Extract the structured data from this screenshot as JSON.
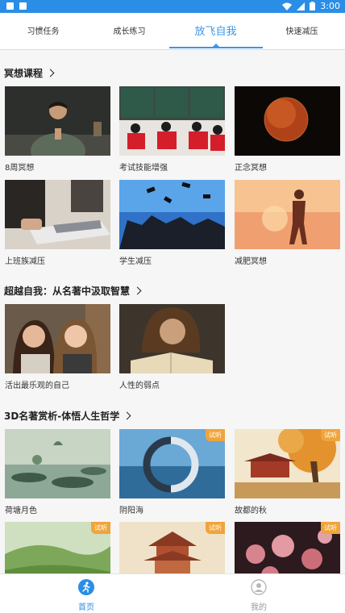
{
  "status_bar": {
    "time": "3:00"
  },
  "tabs": [
    {
      "label": "习惯任务"
    },
    {
      "label": "成长练习"
    },
    {
      "label": "放飞自我"
    },
    {
      "label": "快速减压"
    }
  ],
  "sections": {
    "meditation": {
      "title": "冥想课程",
      "cards": [
        {
          "label": "8周冥想",
          "image": "woman-meditating-image"
        },
        {
          "label": "考试技能增强",
          "image": "exam-classroom-image"
        },
        {
          "label": "正念冥想",
          "image": "eclipse-moon-image"
        },
        {
          "label": "上班族减压",
          "image": "office-laptop-image"
        },
        {
          "label": "学生减压",
          "image": "graduation-image"
        },
        {
          "label": "减肥冥想",
          "image": "runner-sunset-image"
        }
      ]
    },
    "beyond": {
      "title": "超越自我：从名著中汲取智慧",
      "cards": [
        {
          "label": "活出最乐观的自己",
          "image": "smiling-girls-image"
        },
        {
          "label": "人性的弱点",
          "image": "reading-man-image"
        }
      ]
    },
    "classics": {
      "title": "3D名著赏析-体悟人生哲学",
      "badge": "试听",
      "cards": [
        {
          "label": "荷塘月色",
          "image": "lotus-pond-image",
          "badge": false
        },
        {
          "label": "阴阳海",
          "image": "yinyang-sea-image",
          "badge": true
        },
        {
          "label": "故都的秋",
          "image": "autumn-pavilion-image",
          "badge": true
        },
        {
          "label": "",
          "image": "meadow-image",
          "badge": true
        },
        {
          "label": "",
          "image": "pagoda-image",
          "badge": true
        },
        {
          "label": "",
          "image": "roses-image",
          "badge": true
        }
      ]
    }
  },
  "bottom_nav": [
    {
      "label": "首页",
      "icon": "runner-icon",
      "active": true
    },
    {
      "label": "我的",
      "icon": "user-icon",
      "active": false
    }
  ],
  "colors": {
    "accent": "#2a8ee6",
    "badge": "#f0a43a"
  }
}
